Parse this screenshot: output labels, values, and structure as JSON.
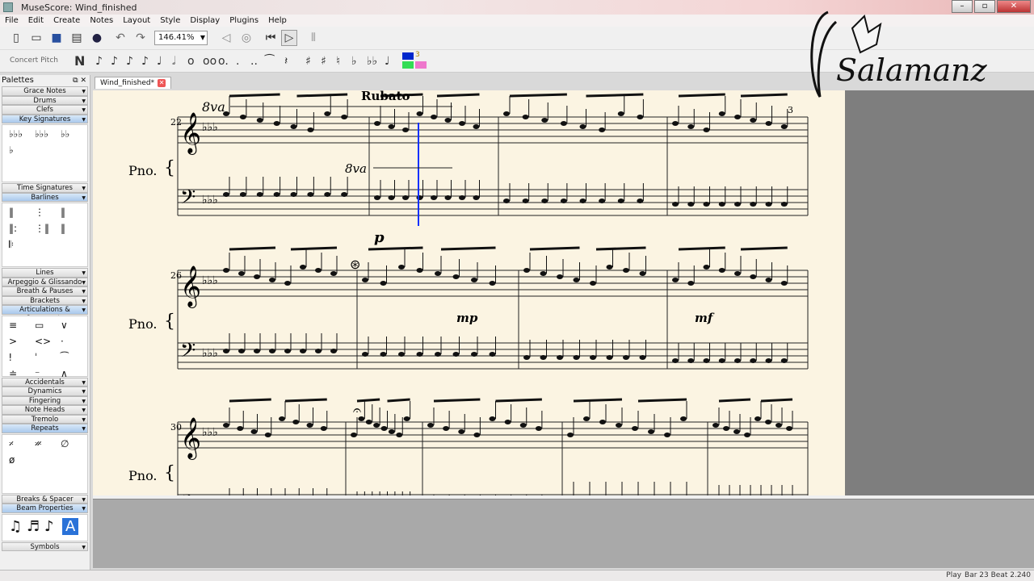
{
  "window": {
    "title": "MuseScore: Wind_finished"
  },
  "menu": [
    "File",
    "Edit",
    "Create",
    "Notes",
    "Layout",
    "Style",
    "Display",
    "Plugins",
    "Help"
  ],
  "toolbar": {
    "zoom": "146.41%",
    "concert_pitch": "Concert Pitch",
    "voice_number": "3"
  },
  "palettes": {
    "title": "Palettes",
    "items": [
      {
        "label": "Grace Notes",
        "open": false
      },
      {
        "label": "Drums",
        "open": false
      },
      {
        "label": "Clefs",
        "open": false
      },
      {
        "label": "Key Signatures",
        "open": true
      },
      {
        "label": "Time Signatures",
        "open": false
      },
      {
        "label": "Barlines",
        "open": true
      },
      {
        "label": "Lines",
        "open": false
      },
      {
        "label": "Arpeggio & Glissando",
        "open": false
      },
      {
        "label": "Breath & Pauses",
        "open": false
      },
      {
        "label": "Brackets",
        "open": false
      },
      {
        "label": "Articulations & Ornaments",
        "open": true
      },
      {
        "label": "Accidentals",
        "open": false
      },
      {
        "label": "Dynamics",
        "open": false
      },
      {
        "label": "Fingering",
        "open": false
      },
      {
        "label": "Note Heads",
        "open": false
      },
      {
        "label": "Tremolo",
        "open": false
      },
      {
        "label": "Repeats",
        "open": true
      },
      {
        "label": "Breaks & Spacer",
        "open": false
      },
      {
        "label": "Beam Properties",
        "open": true
      },
      {
        "label": "Symbols",
        "open": false
      }
    ]
  },
  "document_tab": "Wind_finished*",
  "score": {
    "instrument": "Pno.",
    "tempo_text": "Rubato",
    "ottava_top": "8va",
    "ottava_bottom": "8va",
    "measure_numbers": [
      "22",
      "26",
      "30"
    ],
    "tuplet": "3",
    "dynamics": {
      "p": "p",
      "mp": "mp",
      "mf": "mf"
    }
  },
  "logo": {
    "text": "Salamanz"
  },
  "status": {
    "mode": "Play",
    "position": "Bar  23 Beat  2.240"
  }
}
